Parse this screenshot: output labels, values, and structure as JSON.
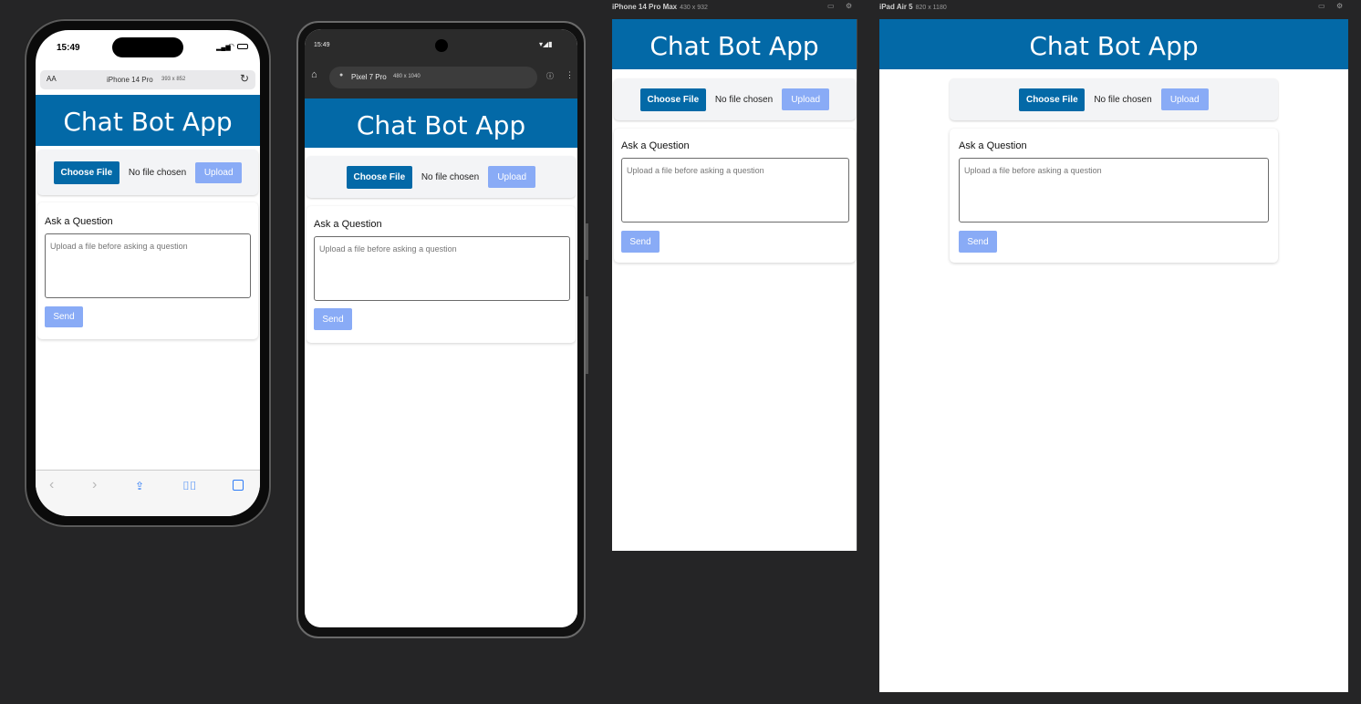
{
  "app": {
    "title": "Chat Bot App",
    "choose_file": "Choose File",
    "no_file": "No file chosen",
    "upload": "Upload",
    "ask_label": "Ask a Question",
    "question_placeholder": "Upload a file before asking a question",
    "send": "Send"
  },
  "iphone14pro": {
    "time": "15:49",
    "text_size": "AA",
    "url_label": "iPhone 14 Pro",
    "url_dims": "393 x 852"
  },
  "pixel7pro": {
    "time": "15:49",
    "url_label": "Pixel 7 Pro",
    "url_dims": "480 x 1040"
  },
  "iphone14promax": {
    "label": "iPhone 14 Pro Max",
    "dims": "430 x 932"
  },
  "ipadair5": {
    "label": "iPad Air 5",
    "dims": "820 x 1180"
  },
  "colors": {
    "brand": "#0369a7",
    "upload_disabled": "#89abf6",
    "canvas": "#252526"
  }
}
